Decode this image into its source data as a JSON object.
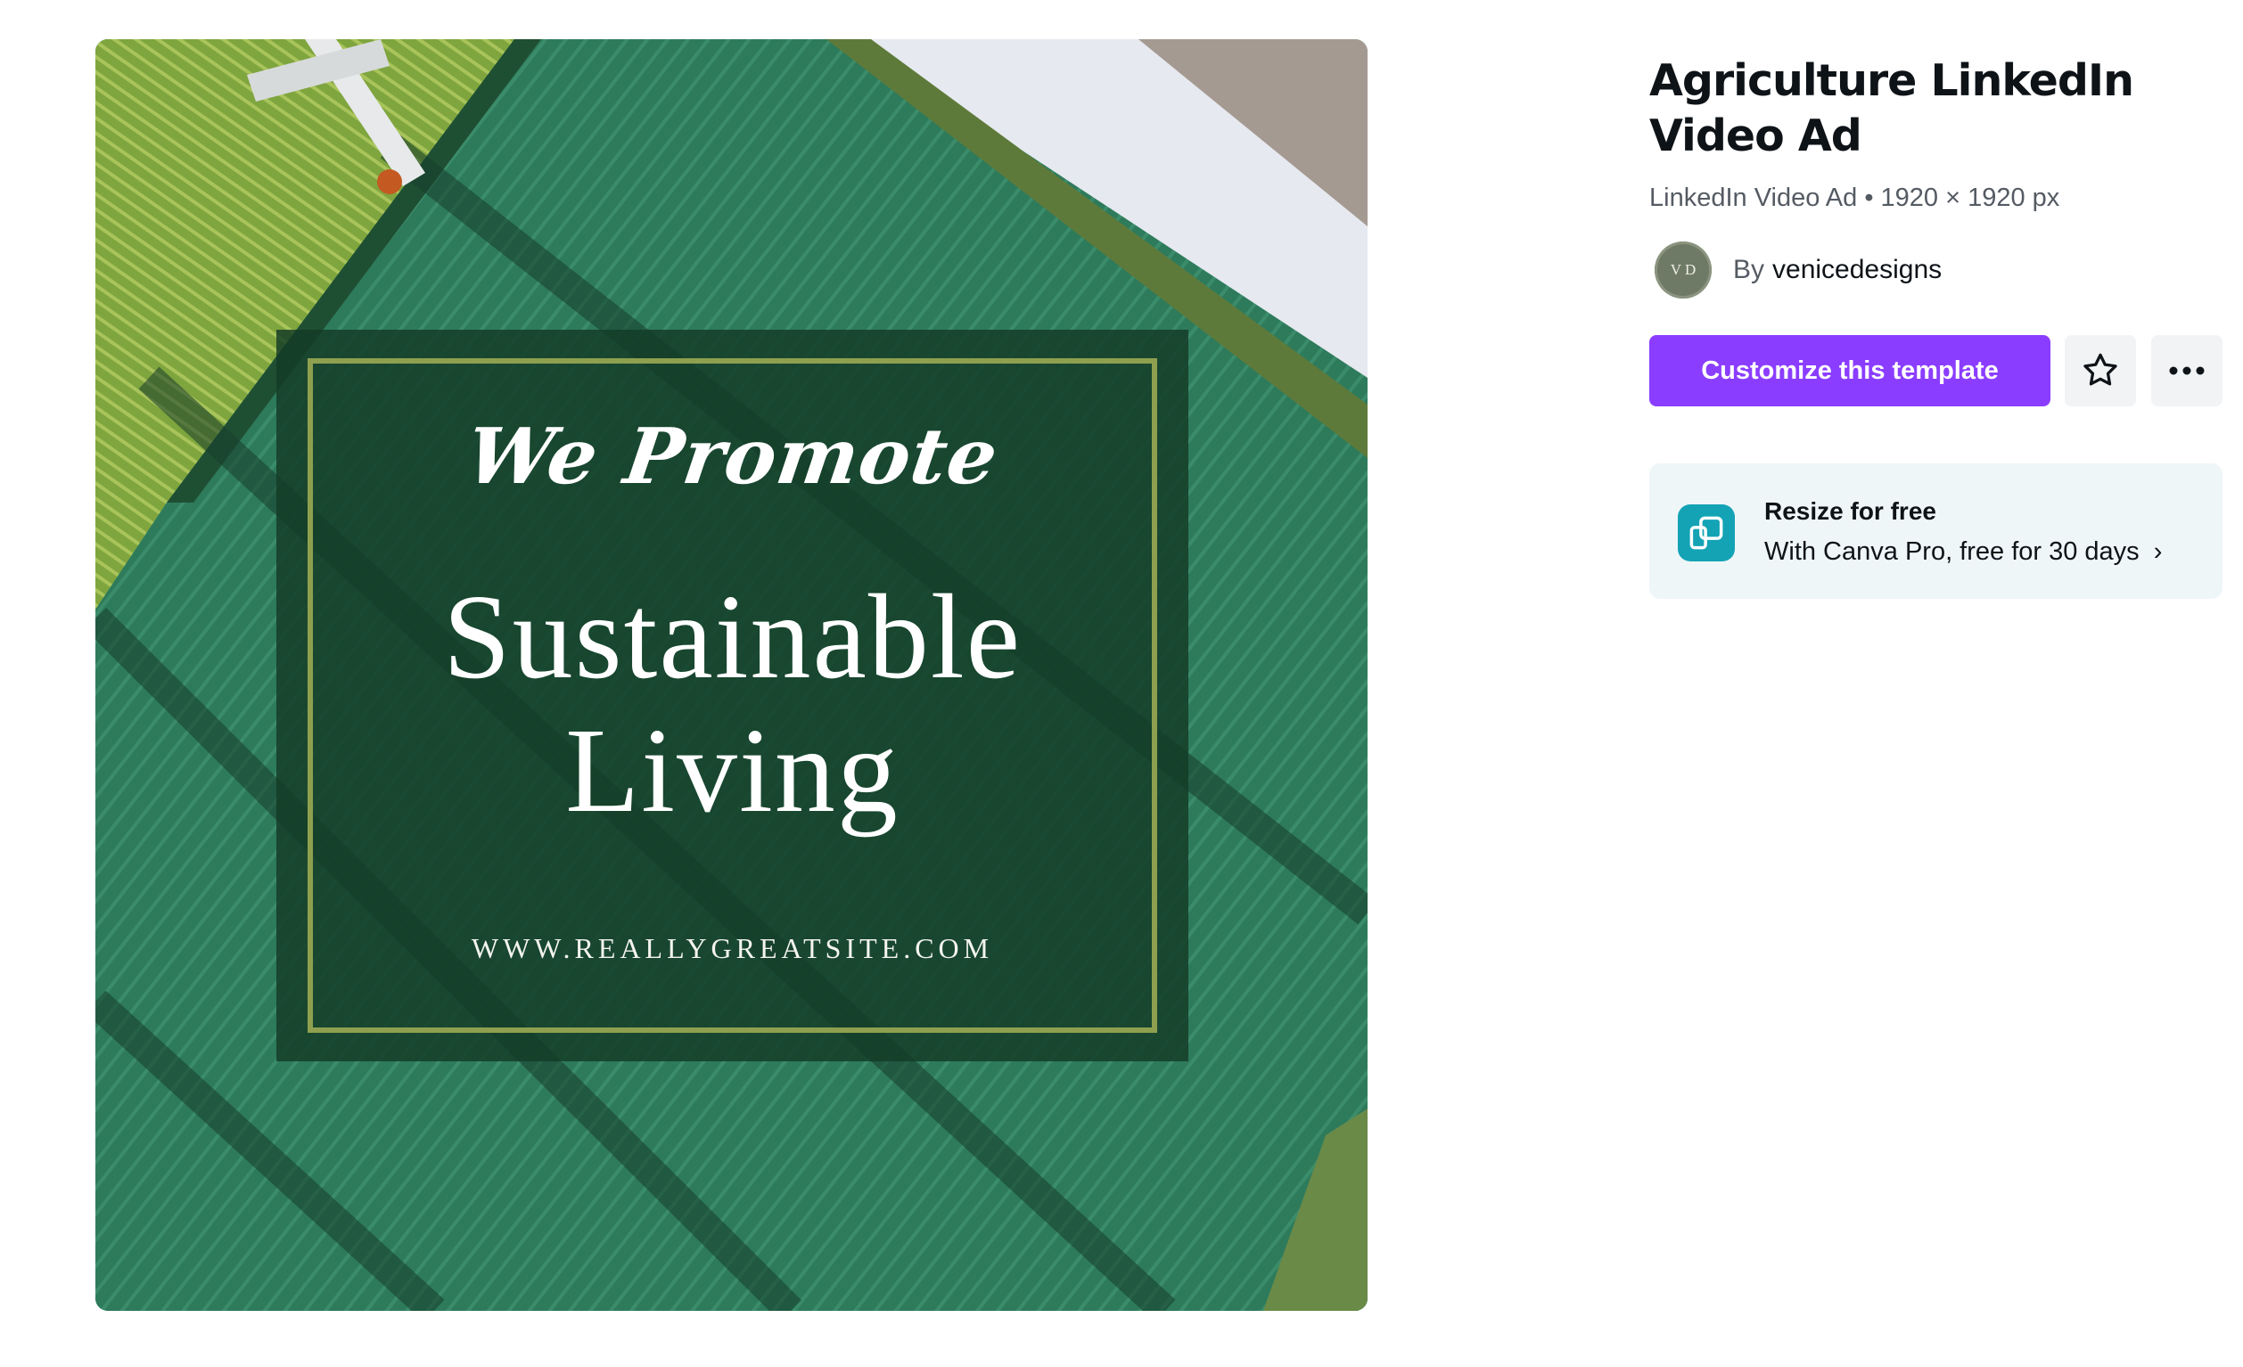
{
  "preview": {
    "script_line": "We Promote",
    "title_line1": "Sustainable",
    "title_line2": "Living",
    "url": "WWW.REALLYGREATSITE.COM"
  },
  "template": {
    "title": "Agriculture LinkedIn Video Ad",
    "meta": "LinkedIn Video Ad • 1920 × 1920 px",
    "by_label": "By",
    "author": "venicedesigns",
    "avatar_initials": "V D"
  },
  "actions": {
    "customize_label": "Customize this template",
    "favorite_icon": "star-icon",
    "more_icon": "more-horizontal-icon"
  },
  "resize_card": {
    "title": "Resize for free",
    "subtitle": "With Canva Pro, free for 30 days",
    "icon": "resize-icon",
    "chevron": "›"
  },
  "colors": {
    "accent": "#8b3dff",
    "resize_icon_bg": "#13a3b5",
    "card_bg": "#eef6f8"
  }
}
